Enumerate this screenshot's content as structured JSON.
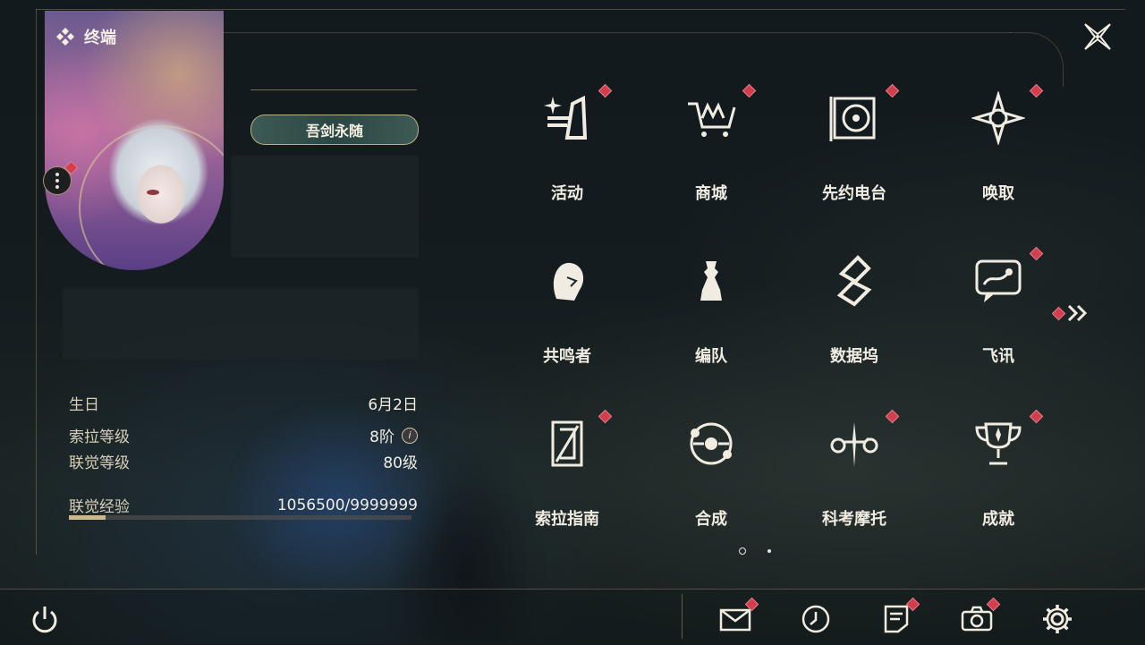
{
  "header": {
    "title": "终端",
    "icon": "diamond-cluster-icon"
  },
  "profile": {
    "title_badge": "吾剑永随",
    "info": [
      {
        "key": "生日",
        "value": "6月2日"
      },
      {
        "key": "索拉等级",
        "value": "8阶"
      },
      {
        "key": "联觉等级",
        "value": "80级"
      },
      {
        "key": "联觉经验",
        "value": "1056500/9999999"
      }
    ],
    "exp_progress": 0.106
  },
  "grid": [
    {
      "label": "活动",
      "icon": "sparkle-icon",
      "badge": true
    },
    {
      "label": "商城",
      "icon": "shop-cart-icon",
      "badge": true
    },
    {
      "label": "先约电台",
      "icon": "radio-icon",
      "badge": true
    },
    {
      "label": "唤取",
      "icon": "compass-star-icon",
      "badge": true
    },
    {
      "label": "共鸣者",
      "icon": "character-icon",
      "badge": false
    },
    {
      "label": "编队",
      "icon": "chess-formation-icon",
      "badge": false
    },
    {
      "label": "数据坞",
      "icon": "data-dock-icon",
      "badge": false
    },
    {
      "label": "飞讯",
      "icon": "message-icon",
      "badge": true
    },
    {
      "label": "索拉指南",
      "icon": "guide-book-icon",
      "badge": true
    },
    {
      "label": "合成",
      "icon": "synthesis-icon",
      "badge": false
    },
    {
      "label": "科考摩托",
      "icon": "motorcycle-icon",
      "badge": true
    },
    {
      "label": "成就",
      "icon": "trophy-icon",
      "badge": true
    }
  ],
  "pager": {
    "pages": 2,
    "current": 1
  },
  "bottom_bar": [
    {
      "name": "mail",
      "icon": "mail-icon",
      "badge": true
    },
    {
      "name": "clock",
      "icon": "clock-icon",
      "badge": false
    },
    {
      "name": "notes",
      "icon": "notes-icon",
      "badge": true
    },
    {
      "name": "camera",
      "icon": "camera-icon",
      "badge": true
    },
    {
      "name": "settings",
      "icon": "gear-icon",
      "badge": false
    }
  ],
  "colors": {
    "accent_gold": "#cbb88e",
    "badge_red": "#d33d4d"
  }
}
